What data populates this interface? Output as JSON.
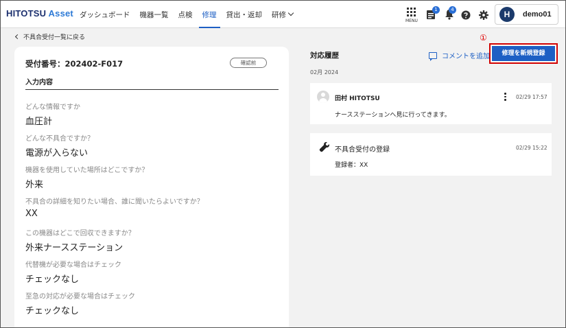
{
  "app": {
    "logo_part1": "HITOTSU",
    "logo_part2": " Asset"
  },
  "nav": {
    "items": [
      {
        "label": "ダッシュボード",
        "active": false
      },
      {
        "label": "機器一覧",
        "active": false
      },
      {
        "label": "点検",
        "active": false
      },
      {
        "label": "修理",
        "active": true
      },
      {
        "label": "貸出・返却",
        "active": false
      },
      {
        "label": "研修",
        "active": false
      }
    ],
    "menu_label": "MENU",
    "mail_badge": "1",
    "notification_badge": "4",
    "user_initial": "H",
    "username": "demo01"
  },
  "back_link": "不具合受付一覧に戻る",
  "record": {
    "number_label": "受付番号：202402-F017",
    "status": "確認前",
    "section_title": "入力内容",
    "fields": [
      {
        "q": "どんな情報ですか",
        "a": "血圧計"
      },
      {
        "q": "どんな不具合ですか？",
        "a": "電源が入らない"
      },
      {
        "q": "機器を使用していた場所はどこですか？",
        "a": "外来"
      },
      {
        "q": "不具合の詳細を知りたい場合、誰に聞いたらよいですか？",
        "a": "XX"
      },
      {
        "q": "この機器はどこで回収できますか？",
        "a": "外来ナースステーション"
      },
      {
        "q": "代替機が必要な場合はチェック",
        "a": "チェックなし"
      },
      {
        "q": "至急の対応が必要な場合はチェック",
        "a": "チェックなし"
      }
    ]
  },
  "history": {
    "title": "対応履歴",
    "add_comment": "コメントを追加",
    "annotation": "①",
    "new_repair_button": "修理を新規登録",
    "month": "02月 2024",
    "entries": [
      {
        "author": "田村 HITOTSU",
        "time": "02/29 17:57",
        "body": "ナースステーションへ見に行ってきます。"
      },
      {
        "title": "不具合受付の登録",
        "time": "02/29 15:22",
        "body": "登録者：XX"
      }
    ]
  },
  "colors": {
    "accent": "#1d5fc4",
    "annotation": "#d00000",
    "logo_dark": "#1b2f6e",
    "logo_light": "#2d7ad6"
  }
}
